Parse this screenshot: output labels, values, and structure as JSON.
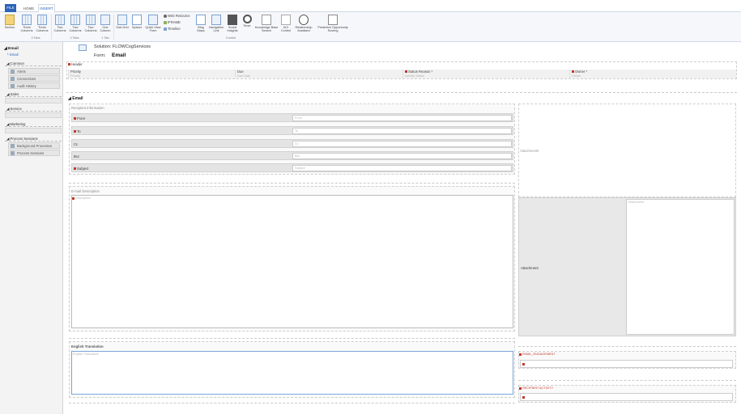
{
  "ribbon": {
    "tabs": [
      "FILE",
      "HOME",
      "INSERT"
    ],
    "buttons": {
      "section": "Section",
      "three_columns_a": "Three Columns",
      "three_columns_b": "Three Columns",
      "two_columns_a": "Two Columns",
      "two_columns_b": "Two Columns",
      "two_columns_c": "Two Columns",
      "one_column": "One Column",
      "sub_grid": "Sub-Grid",
      "spacer": "Spacer",
      "quick_view_form": "Quick View Form",
      "web_resource": "Web Resource",
      "iframe": "IFRAME",
      "timeline": "Timeline",
      "bing_maps": "Bing Maps",
      "navigation_link": "Navigation Link",
      "social_insights": "Social Insights",
      "timer": "Timer",
      "knowledge_base_search": "Knowledge Base Search",
      "aci_control": "ACI Control",
      "relationship_assistant": "Relationship Assistant",
      "predictive_opportunity_scoring": "Predictive Opportunity Scoring"
    },
    "groups": {
      "three_tabs": "3 Tabs",
      "two_tabs": "2 Tabs",
      "one_tab": "1 Tab",
      "control": "Control"
    }
  },
  "leftnav": {
    "entity": "Email",
    "entity_sub": "Email",
    "groups": [
      {
        "title": "Common",
        "items": [
          "Alerts",
          "Connections",
          "Audit History"
        ]
      },
      {
        "title": "Sales",
        "items": []
      },
      {
        "title": "Service",
        "items": []
      },
      {
        "title": "Marketing",
        "items": []
      },
      {
        "title": "Process Sessions",
        "items": [
          "Background Processes",
          "Process Sessions"
        ]
      }
    ]
  },
  "main": {
    "solution": "Solution: FLOWCogServices",
    "form_label": "Form:",
    "form_name": "Email",
    "header": {
      "title": "Header",
      "fields": [
        {
          "label": "Priority",
          "placeholder": "Priority"
        },
        {
          "label": "Due",
          "placeholder": "Due Date"
        },
        {
          "label": "Status Reason *",
          "placeholder": "Activity Status"
        },
        {
          "label": "Owner *",
          "placeholder": "Owner"
        }
      ]
    },
    "email_tab": "Email",
    "recipient_section": "Recipient Information",
    "recipient_fields": [
      {
        "label": "From",
        "placeholder": "From"
      },
      {
        "label": "To",
        "placeholder": "To"
      },
      {
        "label": "Cc",
        "placeholder": "Cc"
      },
      {
        "label": "Bcc",
        "placeholder": "Bcc"
      },
      {
        "label": "Subject",
        "placeholder": "Subject"
      }
    ],
    "description_section": "E-mail Description",
    "description_placeholder": "Description",
    "translation_section": "English Translation",
    "translation_placeholder": "English Translation",
    "attachments_section": "Attachments",
    "attachment_label": "Attachment",
    "attachment_grid_placeholder": "Attachment",
    "email_engagement": "EMAIL_ENGAGEMENT",
    "recipient_activity": "RECIPIENT ACTIVITY"
  }
}
